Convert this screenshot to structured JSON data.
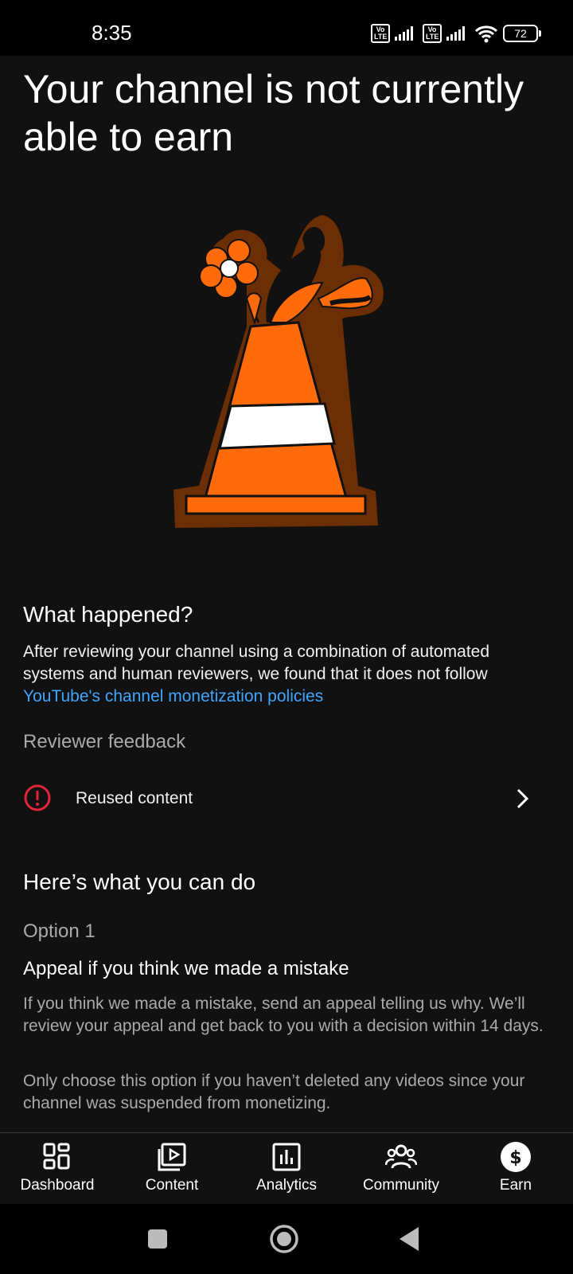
{
  "status_bar": {
    "time": "8:35",
    "volte_1": "Vo LTE",
    "volte_2": "Vo LTE",
    "battery": "72"
  },
  "page": {
    "title": "Your channel is not currently able to earn"
  },
  "what_happened": {
    "heading": "What happened?",
    "body": "After reviewing your channel using a combination of automated systems and human reviewers, we found that it does not follow",
    "link": "YouTube's channel monetization policies"
  },
  "reviewer_feedback": {
    "heading": "Reviewer feedback",
    "item_label": "Reused content"
  },
  "what_you_can_do": {
    "heading": "Here’s what you can do",
    "option_label": "Option 1",
    "option_title": "Appeal if you think we made a mistake",
    "option_desc": "If you think we made a mistake, send an appeal telling us why. We’ll review your appeal and get back to you with a decision within 14 days.",
    "option_note": "Only choose this option if you haven’t deleted any videos since your channel was suspended from monetizing."
  },
  "bottom_nav": {
    "items": [
      {
        "label": "Dashboard",
        "icon": "dashboard-icon"
      },
      {
        "label": "Content",
        "icon": "content-icon"
      },
      {
        "label": "Analytics",
        "icon": "analytics-icon"
      },
      {
        "label": "Community",
        "icon": "community-icon"
      },
      {
        "label": "Earn",
        "icon": "earn-icon",
        "selected": true
      }
    ]
  },
  "colors": {
    "background": "#111111",
    "link": "#3ea6ff",
    "alert": "#e0243a",
    "cone_orange": "#ff6b0a",
    "cone_outline": "#6b2e05"
  }
}
